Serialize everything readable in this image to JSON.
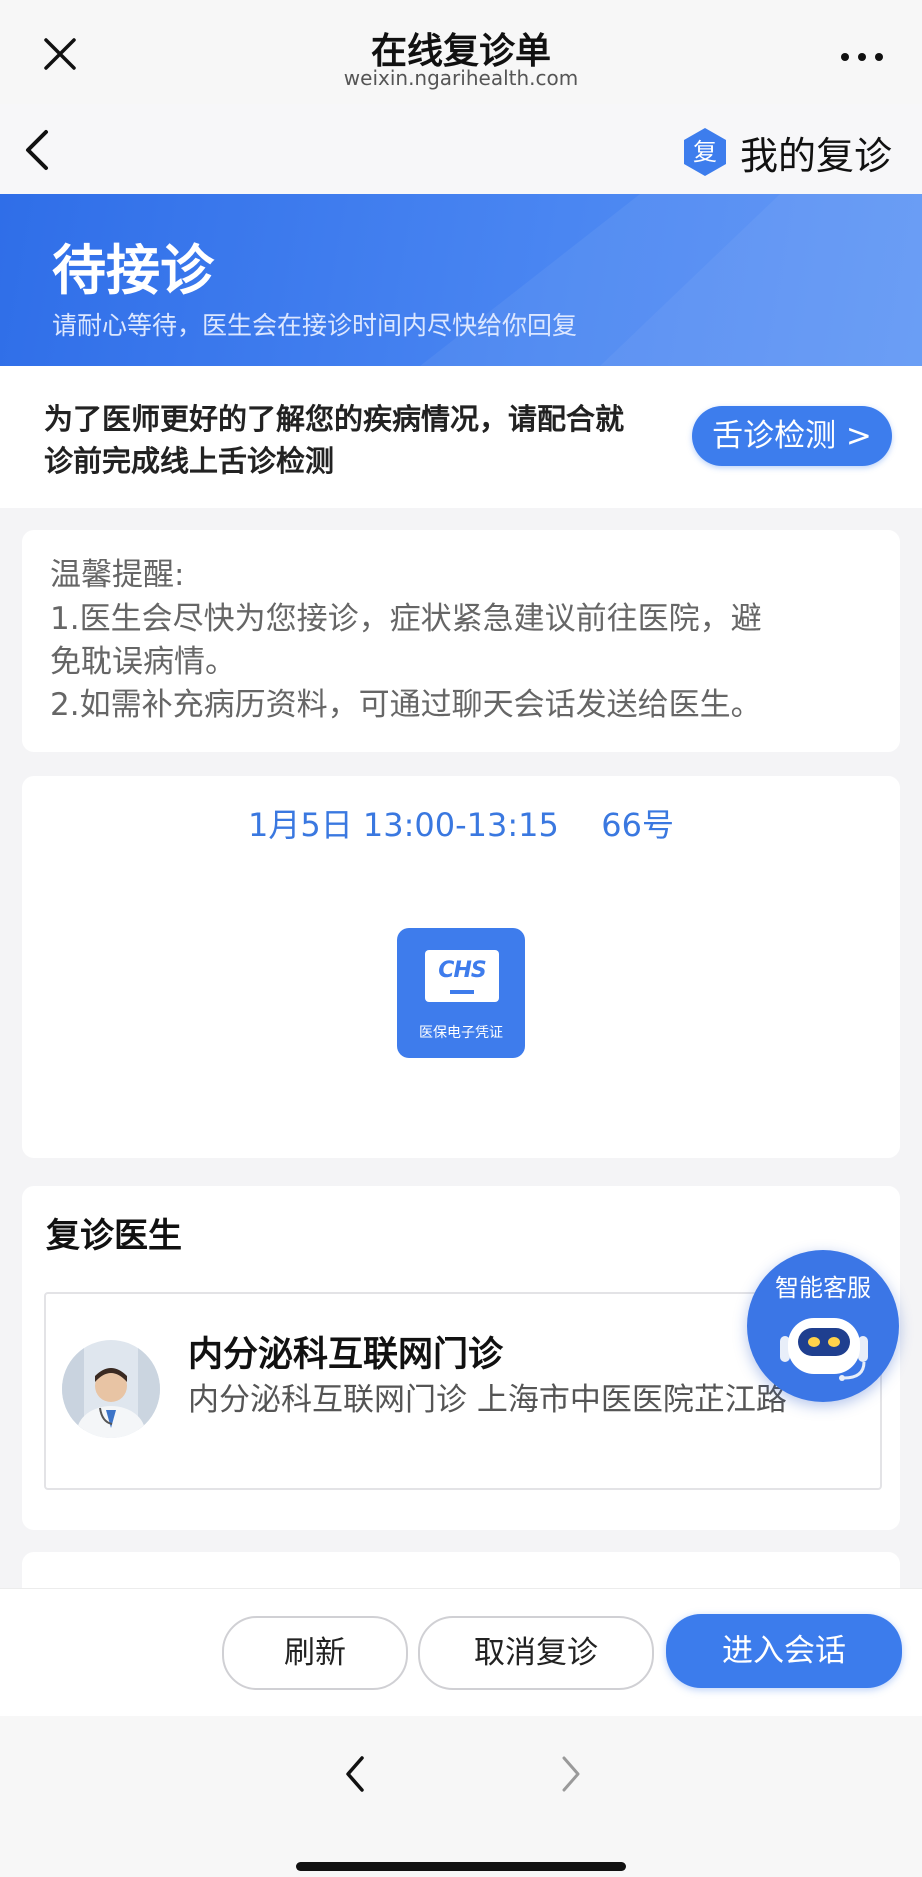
{
  "window": {
    "title": "在线复诊单",
    "url": "weixin.ngarihealth.com",
    "close_icon": "close-icon",
    "more_icon": "more-icon"
  },
  "header": {
    "back_icon": "chevron-left-icon",
    "my_revisit_badge": "复",
    "my_revisit_label": "我的复诊"
  },
  "status": {
    "title": "待接诊",
    "subtitle": "请耐心等待，医生会在接诊时间内尽快给你回复"
  },
  "tongue_check": {
    "text": "为了医师更好的了解您的疾病情况，请配合就诊前完成线上舌诊检测",
    "button_label": "舌诊检测 >"
  },
  "notice": {
    "title": "温馨提醒:",
    "line1": "1.医生会尽快为您接诊，症状紧急建议前往医院，避",
    "line2": "免耽误病情。",
    "line3": "2.如需补充病历资料，可通过聊天会话发送给医生。"
  },
  "appointment": {
    "time": "1月5日 13:00-13:15",
    "number": "66号",
    "insurance_logo": "CHS",
    "insurance_label": "医保电子凭证"
  },
  "doctor": {
    "section_title": "复诊医生",
    "name": "内分泌科互联网门诊",
    "description": "内分泌科互联网门诊 上海市中医医院芷江路"
  },
  "customer_service": {
    "label": "智能客服",
    "icon": "robot-icon"
  },
  "actions": {
    "refresh": "刷新",
    "cancel": "取消复诊",
    "enter": "进入会话"
  },
  "browser_nav": {
    "back_icon": "chevron-left-icon",
    "forward_icon": "chevron-right-icon"
  }
}
